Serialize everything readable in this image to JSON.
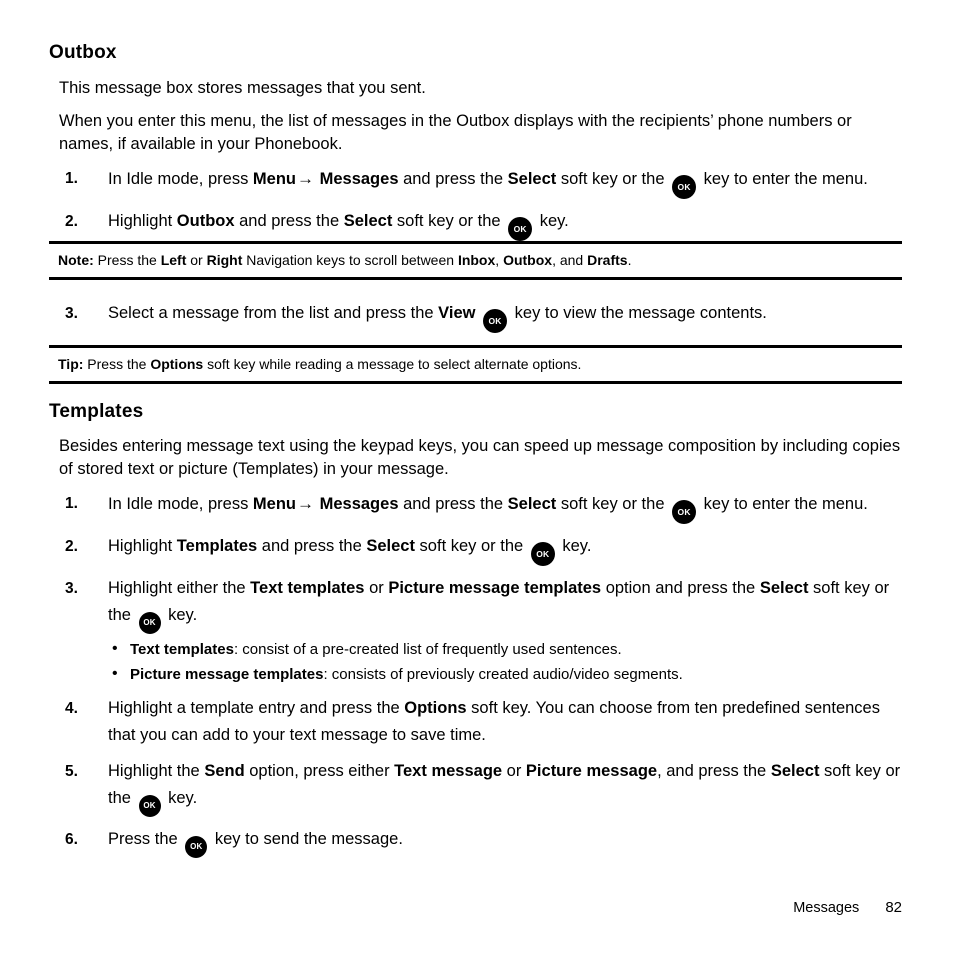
{
  "document": {
    "sections": [
      {
        "id": "outbox",
        "heading": "Outbox",
        "paragraphs": [
          "This message box stores messages that you sent.",
          "When you enter this menu, the list of messages in the Outbox displays with the recipients’ phone numbers or names, if available in your Phonebook."
        ]
      },
      {
        "id": "templates",
        "heading": "Templates",
        "paragraphs": [
          "Besides entering message text using the keypad keys, you can speed up message composition by including copies of stored text or picture (Templates) in your message."
        ]
      }
    ]
  },
  "outbox_steps": {
    "step1": {
      "num": "1.",
      "t1": "In Idle mode, press ",
      "b1": "Menu",
      "arrow": "→",
      "b2": "Messages",
      "t2": " and press the ",
      "b3": "Select",
      "t3": " soft key or the ",
      "key": "OK",
      "t4": " key to enter the menu."
    },
    "step2": {
      "num": "2.",
      "t1": "Highlight ",
      "b1": "Outbox",
      "t2": " and press the ",
      "b2": "Select",
      "t3": " soft key or the ",
      "key": "OK",
      "t4": " key."
    },
    "step3": {
      "num": "3.",
      "t1": "Select a message from the list and press the ",
      "b1": "View",
      "key": "OK",
      "t2": " key to view the message contents."
    }
  },
  "note": {
    "label": "Note:",
    "t1": " Press the ",
    "b1": "Left",
    "t2": " or ",
    "b2": "Right",
    "t3": " Navigation keys to scroll between ",
    "b3": "Inbox",
    "t4": ", ",
    "b4": "Outbox",
    "t5": ", and ",
    "b5": "Drafts",
    "t6": "."
  },
  "tip": {
    "label": "Tip:",
    "t1": " Press the ",
    "b1": "Options",
    "t2": " soft key while reading a message to select alternate options."
  },
  "templates_steps": {
    "step1": {
      "num": "1.",
      "t1": "In Idle mode, press ",
      "b1": "Menu",
      "arrow": "→",
      "b2": "Messages",
      "t2": " and press the ",
      "b3": "Select",
      "t3": " soft key or the ",
      "key": "OK",
      "t4": " key to enter the menu."
    },
    "step2": {
      "num": "2.",
      "t1": "Highlight ",
      "b1": "Templates",
      "t2": " and press the ",
      "b2": "Select",
      "t3": " soft key or the ",
      "key": "OK",
      "t4": " key."
    },
    "step3": {
      "num": "3.",
      "t1": "Highlight either the ",
      "b1": "Text templates",
      "t2": " or ",
      "b2": "Picture message templates",
      "t3": " option and press the ",
      "b3": "Select",
      "t4": " soft key or the ",
      "key": "OK",
      "t5": " key."
    },
    "step4": {
      "num": "4.",
      "t1": "Highlight a template entry and press the ",
      "b1": "Options",
      "t2": " soft key. You can choose from ten predefined sentences that you can add to your text message to save time."
    },
    "step5": {
      "num": "5.",
      "t1": "Highlight the ",
      "b1": "Send",
      "t2": " option, press either ",
      "b2": "Text message",
      "t3": " or ",
      "b3": "Picture message",
      "t4": ", and press the ",
      "b4": "Select",
      "t5": " soft key or the ",
      "key": "OK",
      "t6": " key."
    },
    "step6": {
      "num": "6.",
      "t1": "Press the ",
      "key": "OK",
      "t2": " key to send the message."
    }
  },
  "bullets": [
    {
      "dot": "•",
      "term": "Text templates",
      "rest": ": consist of a pre-created list of frequently used sentences."
    },
    {
      "dot": "•",
      "term": "Picture message templates",
      "rest": ": consists of previously created audio/video segments."
    }
  ],
  "footer": {
    "chapter": "Messages",
    "page": "82"
  }
}
